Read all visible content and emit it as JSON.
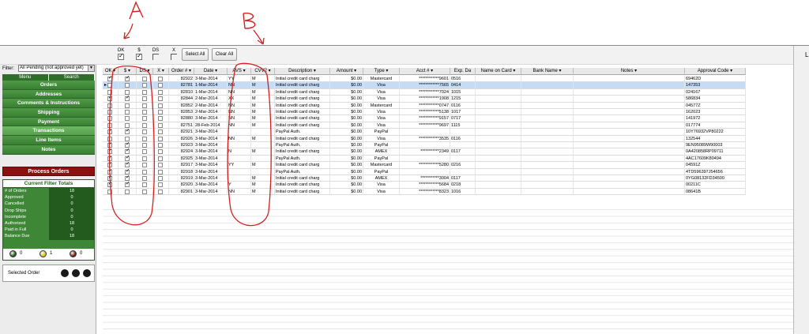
{
  "toolbar": {
    "checks": [
      {
        "label": "OK",
        "checked": true
      },
      {
        "label": "$",
        "checked": true
      },
      {
        "label": "DS",
        "checked": false
      },
      {
        "label": "X",
        "checked": false
      }
    ],
    "select_all": "Select All",
    "clear_all": "Clear All",
    "right_letter": "L"
  },
  "sidebar": {
    "filter_label": "Filter:",
    "filter_value": "All Pending (not approved yet)",
    "tabs": [
      "Menu",
      "Search"
    ],
    "nav": [
      "Orders",
      "Addresses",
      "Comments & Instructions",
      "Shipping",
      "Payment",
      "Transactions",
      "Line Items",
      "Notes"
    ],
    "selected_nav": "Transactions",
    "process_orders": "Process Orders",
    "totals_title": "Current Filter Totals",
    "totals": [
      {
        "label": "# of Orders",
        "value": "18"
      },
      {
        "label": "Approved",
        "value": "0"
      },
      {
        "label": "Cancelled",
        "value": "0"
      },
      {
        "label": "Drop Ships",
        "value": "0"
      },
      {
        "label": "Incomplete",
        "value": "0"
      },
      {
        "label": "Authorized",
        "value": "18"
      },
      {
        "label": "Paid in Full",
        "value": "0"
      },
      {
        "label": "Balance Due",
        "value": "18"
      }
    ],
    "legend": [
      {
        "count": "0",
        "color": "#1f5e1a"
      },
      {
        "count": "1",
        "color": "#d6c21c"
      },
      {
        "count": "0",
        "color": "#7a1a10"
      }
    ],
    "selected_order_label": "Selected Order"
  },
  "grid": {
    "columns": [
      "OK",
      "$",
      "DS",
      "X",
      "Order #",
      "Date",
      "AVS",
      "CVV2",
      "Description",
      "Amount",
      "Type",
      "Acct #",
      "Exp. Da",
      "Name on Card",
      "Bank Name",
      "Notes",
      "Approval Code"
    ],
    "rows": [
      {
        "ok": true,
        "pay": true,
        "ds": false,
        "x": false,
        "order": "82922",
        "date": "3-Mar-2014",
        "avs": "YY",
        "cvv": "M",
        "desc": "Initial credit card charg",
        "amount": "$0.00",
        "type": "Mastercard",
        "acct": "************9601",
        "exp": "0516",
        "approval": "69462D"
      },
      {
        "ok": false,
        "pay": false,
        "ds": false,
        "x": false,
        "order": "82781",
        "date": "1-Mar-2014",
        "avs": "NN",
        "cvv": "M",
        "desc": "Initial credit card charg",
        "amount": "$0.00",
        "type": "Visa",
        "acct": "************7565",
        "exp": "0414",
        "approval": "147353"
      },
      {
        "ok": false,
        "pay": false,
        "ds": false,
        "x": false,
        "order": "82810",
        "date": "1-Mar-2014",
        "avs": "NN",
        "cvv": "M",
        "desc": "Initial credit card charg",
        "amount": "$0.00",
        "type": "Visa",
        "acct": "************7024",
        "exp": "1015",
        "approval": "024167"
      },
      {
        "ok": true,
        "pay": true,
        "ds": false,
        "x": false,
        "order": "82844",
        "date": "2-Mar-2014",
        "avs": "XX",
        "cvv": "M",
        "desc": "Initial credit card charg",
        "amount": "$0.00",
        "type": "Visa",
        "acct": "************1908",
        "exp": "1215",
        "approval": "586834"
      },
      {
        "ok": false,
        "pay": false,
        "ds": false,
        "x": false,
        "order": "82852",
        "date": "2-Mar-2014",
        "avs": "NN",
        "cvv": "M",
        "desc": "Initial credit card charg",
        "amount": "$0.00",
        "type": "Mastercard",
        "acct": "************0747",
        "exp": "0116",
        "approval": "04577Z"
      },
      {
        "ok": false,
        "pay": false,
        "ds": false,
        "x": false,
        "order": "82853",
        "date": "2-Mar-2014",
        "avs": "NN",
        "cvv": "M",
        "desc": "Initial credit card charg",
        "amount": "$0.00",
        "type": "Visa",
        "acct": "************5138",
        "exp": "1017",
        "approval": "162023"
      },
      {
        "ok": false,
        "pay": false,
        "ds": false,
        "x": false,
        "order": "82880",
        "date": "3-Mar-2014",
        "avs": "NN",
        "cvv": "M",
        "desc": "Initial credit card charg",
        "amount": "$0.00",
        "type": "Visa",
        "acct": "************9157",
        "exp": "0717",
        "approval": "141972"
      },
      {
        "ok": false,
        "pay": false,
        "ds": false,
        "x": false,
        "order": "82751",
        "date": "28-Feb-2014",
        "avs": "NN",
        "cvv": "M",
        "desc": "Initial credit card charg",
        "amount": "$0.00",
        "type": "Visa",
        "acct": "************9697",
        "exp": "1115",
        "approval": "017774"
      },
      {
        "ok": true,
        "pay": true,
        "ds": false,
        "x": false,
        "order": "82921",
        "date": "3-Mar-2014",
        "avs": "",
        "cvv": "",
        "desc": "PayPal Auth.",
        "amount": "$0.00",
        "type": "PayPal",
        "acct": "",
        "exp": "",
        "approval": "10Y76932VP80222"
      },
      {
        "ok": false,
        "pay": false,
        "ds": false,
        "x": false,
        "order": "82926",
        "date": "3-Mar-2014",
        "avs": "NN",
        "cvv": "M",
        "desc": "Initial credit card charg",
        "amount": "$0.00",
        "type": "Visa",
        "acct": "************3535",
        "exp": "0116",
        "approval": "132544"
      },
      {
        "ok": true,
        "pay": true,
        "ds": false,
        "x": false,
        "order": "82923",
        "date": "3-Mar-2014",
        "avs": "",
        "cvv": "",
        "desc": "PayPal Auth.",
        "amount": "$0.00",
        "type": "PayPal",
        "acct": "",
        "exp": "",
        "approval": "9EN95089W90003"
      },
      {
        "ok": true,
        "pay": true,
        "ds": false,
        "x": false,
        "order": "82924",
        "date": "3-Mar-2014",
        "avs": "N",
        "cvv": "M",
        "desc": "Initial credit card charg",
        "amount": "$0.00",
        "type": "AMEX",
        "acct": "***********2349",
        "exp": "0117",
        "approval": "0A420858RP09711"
      },
      {
        "ok": true,
        "pay": true,
        "ds": false,
        "x": false,
        "order": "82925",
        "date": "3-Mar-2014",
        "avs": "",
        "cvv": "",
        "desc": "PayPal Auth.",
        "amount": "$0.00",
        "type": "PayPal",
        "acct": "",
        "exp": "",
        "approval": "4AC17609K80494"
      },
      {
        "ok": true,
        "pay": true,
        "ds": false,
        "x": false,
        "order": "82917",
        "date": "3-Mar-2014",
        "avs": "YY",
        "cvv": "M",
        "desc": "Initial credit card charg",
        "amount": "$0.00",
        "type": "Mastercard",
        "acct": "************5280",
        "exp": "0216",
        "approval": "04591Z"
      },
      {
        "ok": true,
        "pay": true,
        "ds": false,
        "x": false,
        "order": "82918",
        "date": "3-Mar-2014",
        "avs": "",
        "cvv": "",
        "desc": "PayPal Auth.",
        "amount": "$0.00",
        "type": "PayPal",
        "acct": "",
        "exp": "",
        "approval": "4TD596397J54656"
      },
      {
        "ok": true,
        "pay": true,
        "ds": false,
        "x": false,
        "order": "82919",
        "date": "3-Mar-2014",
        "avs": "",
        "cvv": "M",
        "desc": "Initial credit card charg",
        "amount": "$0.00",
        "type": "AMEX",
        "acct": "***********3004",
        "exp": "0117",
        "approval": "0YG08132FD34500"
      },
      {
        "ok": true,
        "pay": true,
        "ds": false,
        "x": false,
        "order": "82920",
        "date": "3-Mar-2014",
        "avs": "Y",
        "cvv": "M",
        "desc": "Initial credit card charg",
        "amount": "$0.00",
        "type": "Visa",
        "acct": "************5684",
        "exp": "0218",
        "approval": "00211C"
      },
      {
        "ok": false,
        "pay": false,
        "ds": false,
        "x": false,
        "order": "82901",
        "date": "3-Mar-2014",
        "avs": "NN",
        "cvv": "M",
        "desc": "Initial credit card charg",
        "amount": "$0.00",
        "type": "Visa",
        "acct": "************8323",
        "exp": "1016",
        "approval": "08641B"
      }
    ],
    "selected_row": 1
  },
  "annotations": {
    "a": "A",
    "b": "B",
    "color": "#d42020"
  }
}
